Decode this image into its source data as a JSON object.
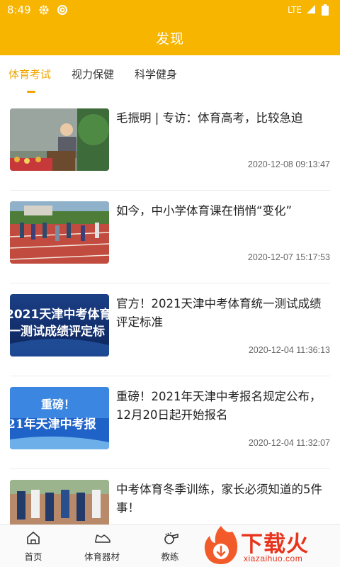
{
  "status_bar": {
    "time": "8:49",
    "network": "LTE"
  },
  "header": {
    "title": "发现"
  },
  "tabs": [
    {
      "label": "体育考试",
      "active": true
    },
    {
      "label": "视力保健",
      "active": false
    },
    {
      "label": "科学健身",
      "active": false
    }
  ],
  "articles": [
    {
      "title": "毛振明 | 专访：体育高考，比较急迫",
      "date": "2020-12-08 09:13:47"
    },
    {
      "title": "如今，中小学体育课在悄悄“变化”",
      "date": "2020-12-07 15:17:53"
    },
    {
      "title": "官方！2021天津中考体育统一测试成绩评定标准",
      "date": "2020-12-04 11:36:13",
      "thumb_lines": [
        "2021天津中考体育",
        "一测试成绩评定标"
      ]
    },
    {
      "title": "重磅！2021年天津中考报名规定公布，12月20日起开始报名",
      "date": "2020-12-04 11:32:07",
      "thumb_lines": [
        "重磅！",
        "21年天津中考报"
      ]
    },
    {
      "title": "中考体育冬季训练，家长必须知道的5件事！",
      "date": ""
    }
  ],
  "bottom_nav": [
    {
      "label": "首页",
      "icon": "home-icon"
    },
    {
      "label": "体育器材",
      "icon": "sneaker-icon"
    },
    {
      "label": "教练",
      "icon": "whistle-icon"
    }
  ],
  "watermark": {
    "text": "下载火",
    "sub": "xiazaihuo.com"
  },
  "colors": {
    "brand": "#f7b500",
    "tab_active": "#f0a500",
    "watermark": "#e8341c"
  }
}
